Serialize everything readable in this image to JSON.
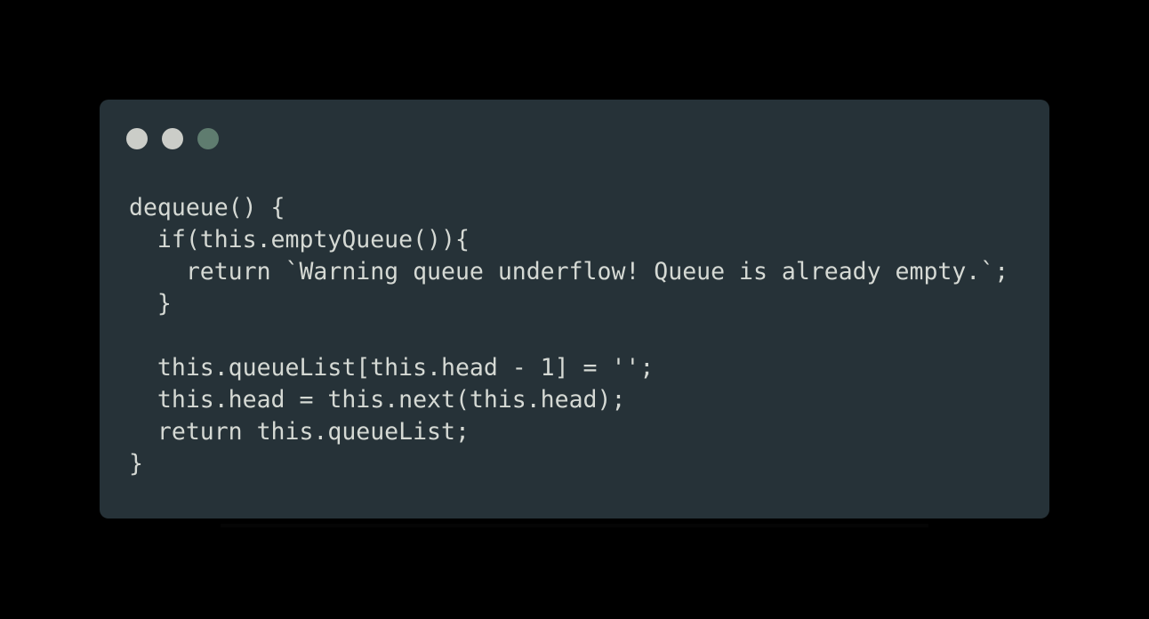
{
  "window": {
    "background": "#263238",
    "controls": [
      {
        "name": "close",
        "color": "#cbcdc8"
      },
      {
        "name": "minimize",
        "color": "#cbcdc8"
      },
      {
        "name": "maximize",
        "color": "#5f7c6f"
      }
    ]
  },
  "code": {
    "text_color": "#d5d9d4",
    "lines": [
      "dequeue() {",
      "  if(this.emptyQueue()){",
      "    return `Warning queue underflow! Queue is already empty.`;",
      "  }",
      "",
      "  this.queueList[this.head - 1] = '';",
      "  this.head = this.next(this.head);",
      "  return this.queueList;",
      "}"
    ]
  }
}
